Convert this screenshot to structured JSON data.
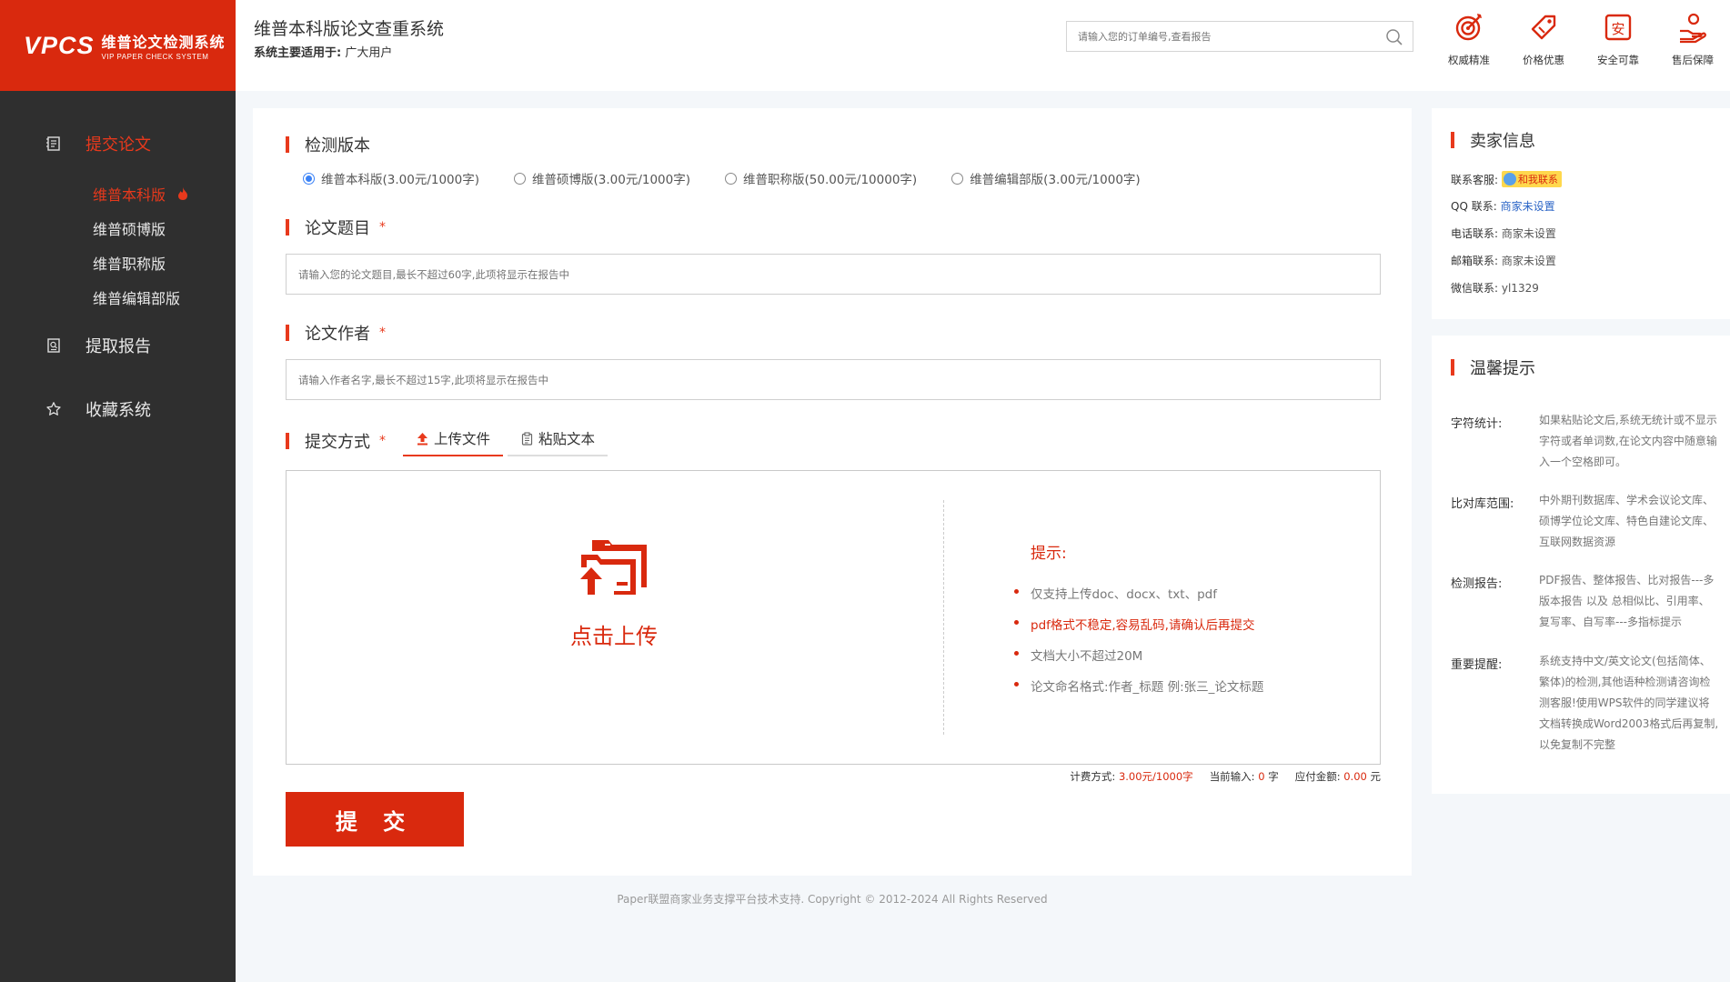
{
  "logo": {
    "mark": "VPCS",
    "cn": "维普论文检测系统",
    "en": "VIP PAPER CHECK SYSTEM"
  },
  "header": {
    "title": "维普本科版论文查重系统",
    "sub_label": "系统主要适用于:",
    "sub_value": "广大用户",
    "search_placeholder": "请输入您的订单编号,查看报告",
    "badges": [
      "权威精准",
      "价格优惠",
      "安全可靠",
      "售后保障"
    ]
  },
  "sidebar": {
    "submit_label": "提交论文",
    "subs": [
      "维普本科版",
      "维普硕博版",
      "维普职称版",
      "维普编辑部版"
    ],
    "report_label": "提取报告",
    "favorite_label": "收藏系统"
  },
  "form": {
    "version_title": "检测版本",
    "versions": [
      "维普本科版(3.00元/1000字)",
      "维普硕博版(3.00元/1000字)",
      "维普职称版(50.00元/10000字)",
      "维普编辑部版(3.00元/1000字)"
    ],
    "title_label": "论文题目",
    "title_placeholder": "请输入您的论文题目,最长不超过60字,此项将显示在报告中",
    "author_label": "论文作者",
    "author_placeholder": "请输入作者名字,最长不超过15字,此项将显示在报告中",
    "method_label": "提交方式",
    "required_mark": "*",
    "tab_upload": "上传文件",
    "tab_paste": "粘贴文本",
    "upload_label": "点击上传",
    "tips_title": "提示:",
    "tips": [
      "仅支持上传doc、docx、txt、pdf",
      "pdf格式不稳定,容易乱码,请确认后再提交",
      "文档大小不超过20M",
      "论文命名格式:作者_标题 例:张三_论文标题"
    ],
    "billing": {
      "method_label": "计费方式:",
      "method_value": "3.00元/1000字",
      "input_label": "当前输入:",
      "input_value": "0",
      "input_unit": "字",
      "amount_label": "应付金额:",
      "amount_value": "0.00",
      "amount_unit": "元"
    },
    "submit_label": "提 交"
  },
  "footer": "Paper联盟商家业务支撑平台技术支持. Copyright © 2012-2024 All Rights Reserved",
  "seller": {
    "title": "卖家信息",
    "service_label": "联系客服:",
    "service_tag": "和我联系",
    "qq_label": "QQ 联系:",
    "qq_value": "商家未设置",
    "phone_label": "电话联系:",
    "phone_value": "商家未设置",
    "email_label": "邮箱联系:",
    "email_value": "商家未设置",
    "wechat_label": "微信联系:",
    "wechat_value": "yl1329"
  },
  "tips_panel": {
    "title": "温馨提示",
    "items": [
      {
        "label": "字符统计:",
        "text": "如果粘贴论文后,系统无统计或不显示字符或者单词数,在论文内容中随意输入一个空格即可。"
      },
      {
        "label": "比对库范围:",
        "text": "中外期刊数据库、学术会议论文库、硕博学位论文库、特色自建论文库、互联网数据资源"
      },
      {
        "label": "检测报告:",
        "text": "PDF报告、整体报告、比对报告---多版本报告 以及 总相似比、引用率、复写率、自写率---多指标提示"
      },
      {
        "label": "重要提醒:",
        "text": "系统支持中文/英文论文(包括简体、繁体)的检测,其他语种检测请咨询检测客服!使用WPS软件的同学建议将文档转换成Word2003格式后再复制,以免复制不完整"
      }
    ]
  },
  "colors": {
    "brand": "#d9290e",
    "sidebar": "#2f2f2f",
    "link": "#2a64c6"
  }
}
